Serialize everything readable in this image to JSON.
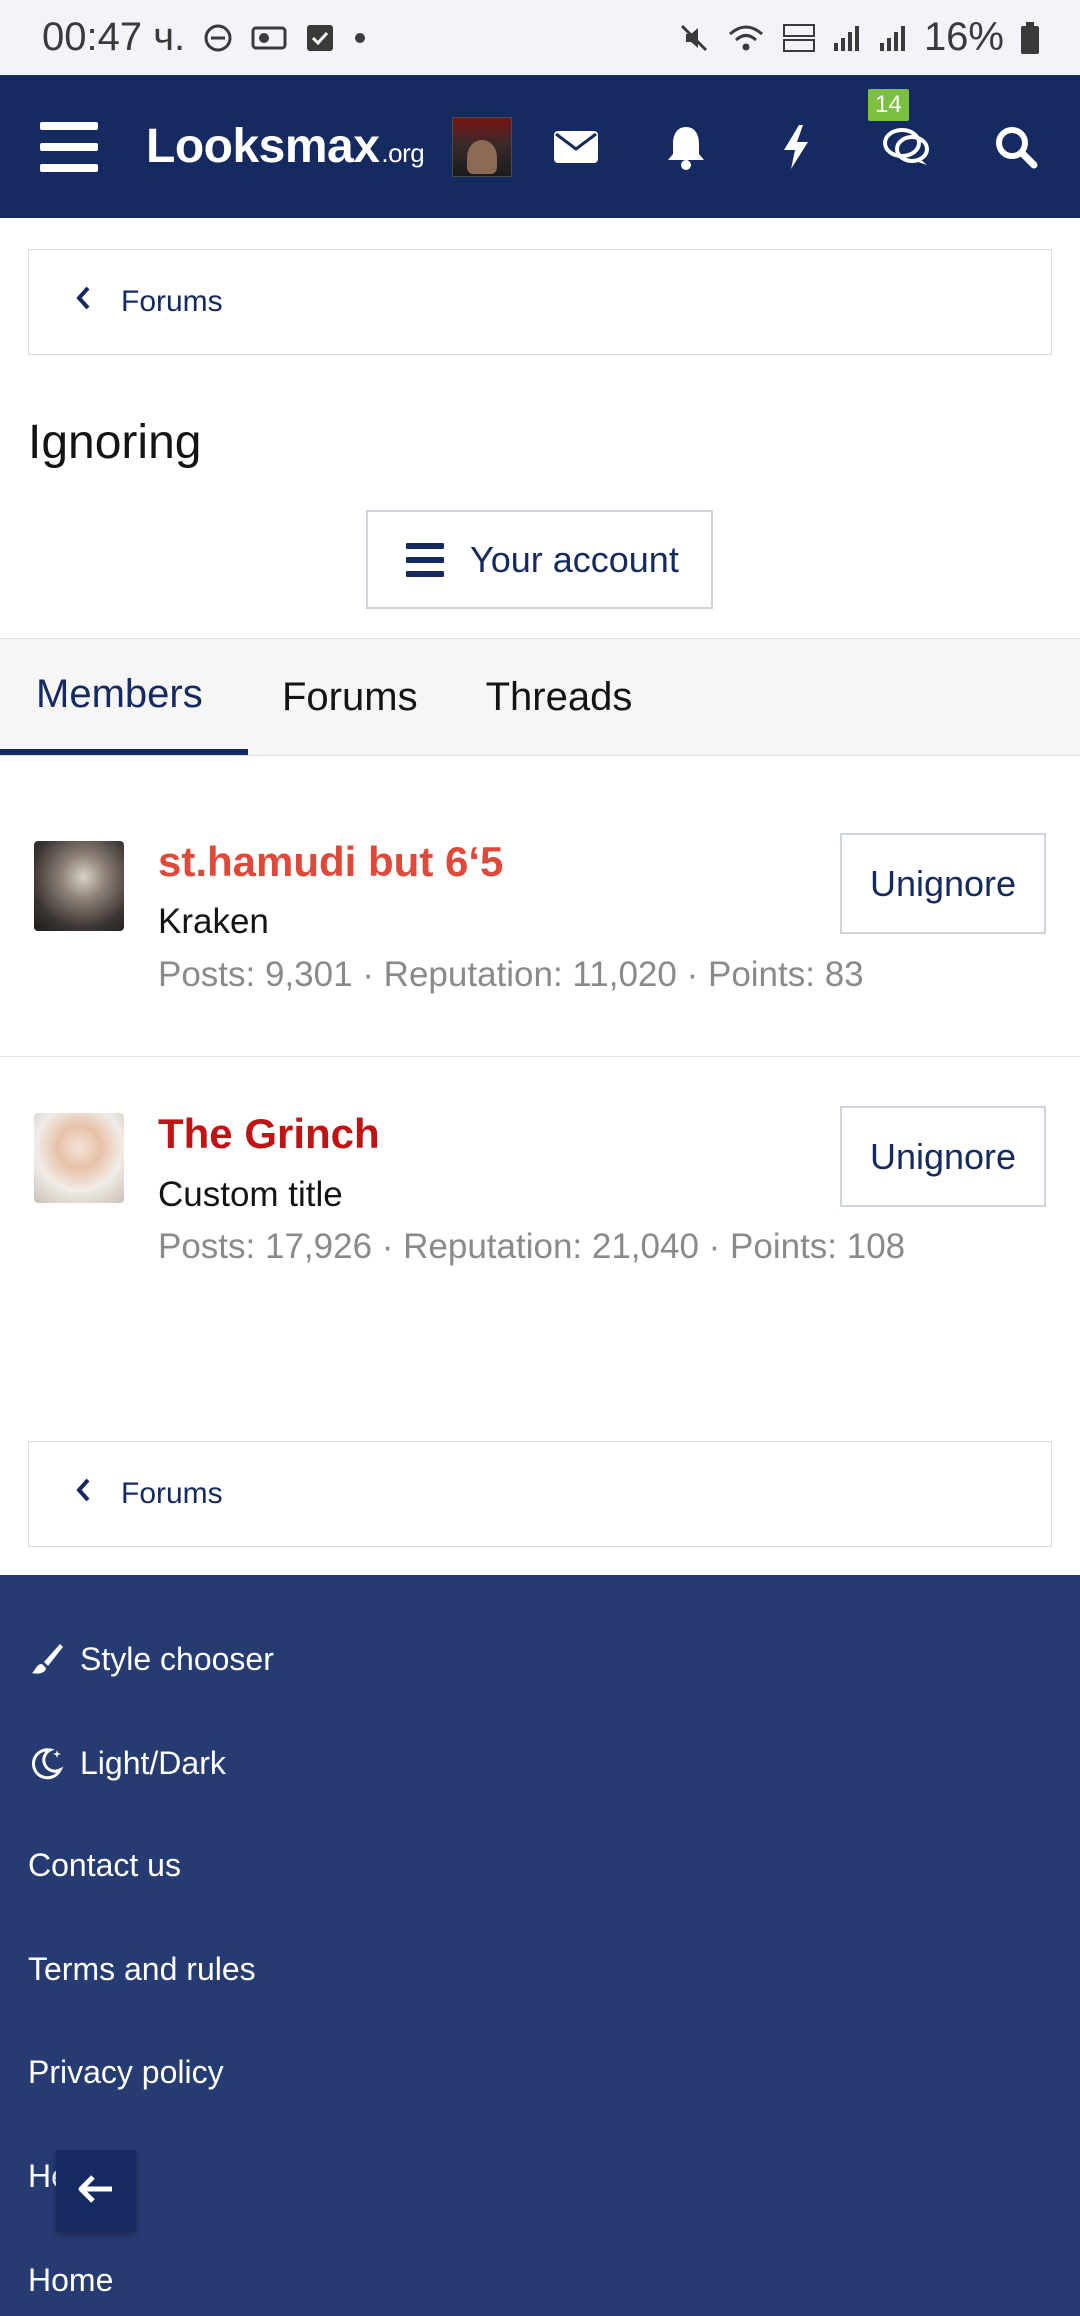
{
  "status_bar": {
    "time": "00:47 ч.",
    "battery": "16%"
  },
  "header": {
    "logo_main": "Looksmax",
    "logo_suffix": ".org",
    "conversations_badge": "14"
  },
  "breadcrumb_top": {
    "label": "Forums"
  },
  "page": {
    "title": "Ignoring",
    "account_button": "Your account"
  },
  "tabs": [
    {
      "label": "Members",
      "active": true
    },
    {
      "label": "Forums",
      "active": false
    },
    {
      "label": "Threads",
      "active": false
    }
  ],
  "members": [
    {
      "name": "st.hamudi but 6‘5",
      "name_color": "#e0493a",
      "title": "Kraken",
      "stats": "Posts: 9,301 · Reputation: 11,020 · Points: 83",
      "action": "Unignore"
    },
    {
      "name": "The Grinch",
      "name_color": "#c01414",
      "title": "Custom title",
      "stats": "Posts: 17,926 · Reputation: 21,040 · Points: 108",
      "action": "Unignore"
    }
  ],
  "breadcrumb_bottom": {
    "label": "Forums"
  },
  "footer": {
    "links": [
      {
        "label": "Style chooser",
        "icon": "brush-icon"
      },
      {
        "label": "Light/Dark",
        "icon": "moon-icon"
      },
      {
        "label": "Contact us"
      },
      {
        "label": "Terms and rules"
      },
      {
        "label": "Privacy policy"
      },
      {
        "label": "Help"
      },
      {
        "label": "Home"
      }
    ]
  },
  "colors": {
    "header_bg": "#152a61",
    "footer_bg": "#273b73",
    "link": "#152a61",
    "badge": "#7bc043"
  }
}
